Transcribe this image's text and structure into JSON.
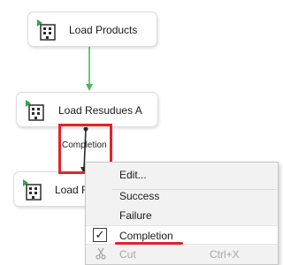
{
  "tasks": [
    {
      "label": "Load Products"
    },
    {
      "label": "Load Resudues A"
    },
    {
      "label": "Load Re"
    }
  ],
  "connector": {
    "label": "Completion"
  },
  "context_menu": {
    "edit": "Edit...",
    "success": "Success",
    "failure": "Failure",
    "completion": "Completion",
    "cut": "Cut",
    "cut_shortcut": "Ctrl+X"
  },
  "colors": {
    "success_line": "#4db56a",
    "completion_line": "#2b2b2b",
    "highlight": "#e0242a",
    "task_icon_flag": "#2aa84a"
  }
}
